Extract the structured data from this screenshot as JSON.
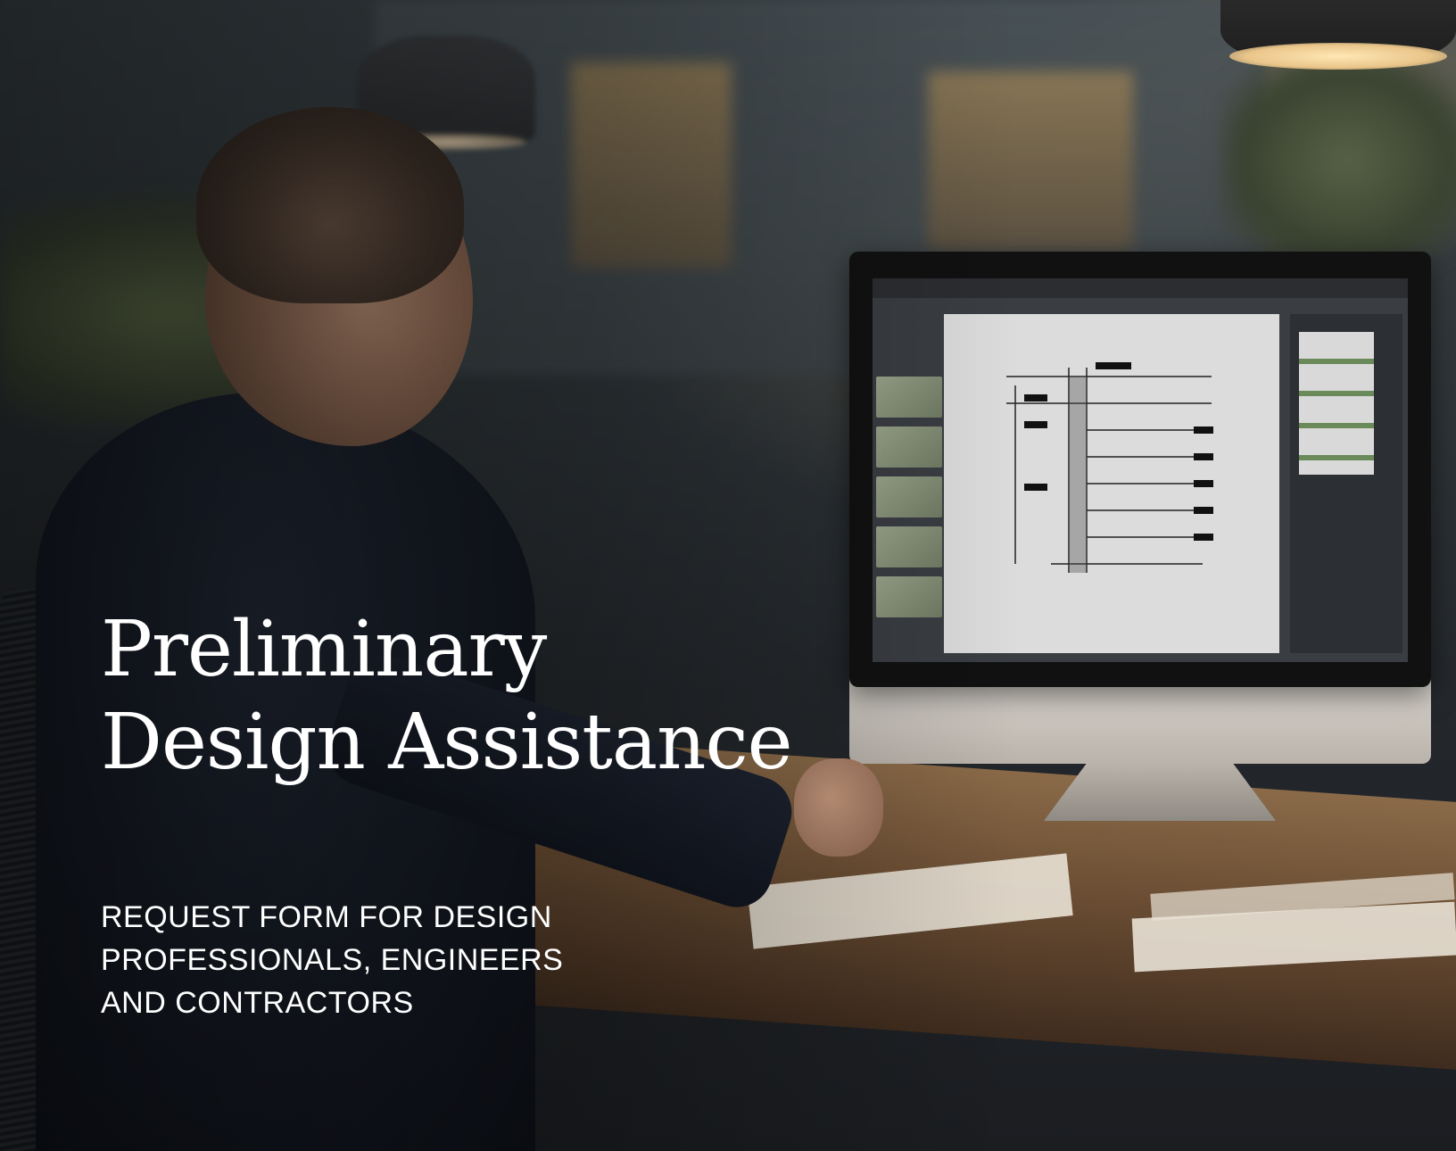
{
  "hero": {
    "title_line1": "Preliminary",
    "title_line2": "Design Assistance",
    "subtitle_line1": "REQUEST FORM FOR DESIGN",
    "subtitle_line2": "PROFESSIONALS, ENGINEERS",
    "subtitle_line3": "AND CONTRACTORS"
  },
  "colors": {
    "text": "#ffffff",
    "background": "#1a1d22"
  }
}
